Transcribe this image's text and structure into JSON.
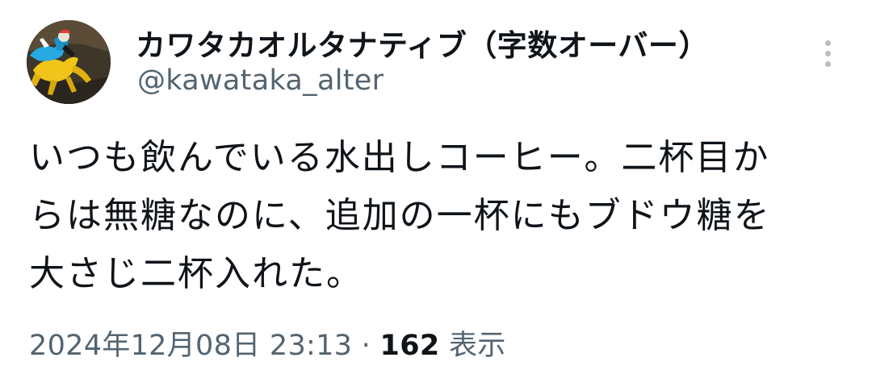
{
  "author": {
    "display_name": "カワタカオルタナティブ（字数オーバー）",
    "handle": "@kawataka_alter",
    "avatar_icon": "horse-racing-avatar-icon"
  },
  "tweet": {
    "text_lines": [
      "いつも飲んでいる水出しコーヒー。二杯目か",
      "らは無糖なのに、追加の一杯にもブドウ糖を",
      "大さじ二杯入れた。"
    ],
    "timestamp": "2024年12月08日 23:13",
    "separator": "·",
    "views_count": "162",
    "views_label": "表示"
  },
  "menu": {
    "icon": "more-vertical-icon"
  },
  "colors": {
    "text_primary": "#0f1419",
    "text_secondary": "#536471",
    "more_dots": "#b6bec5"
  }
}
